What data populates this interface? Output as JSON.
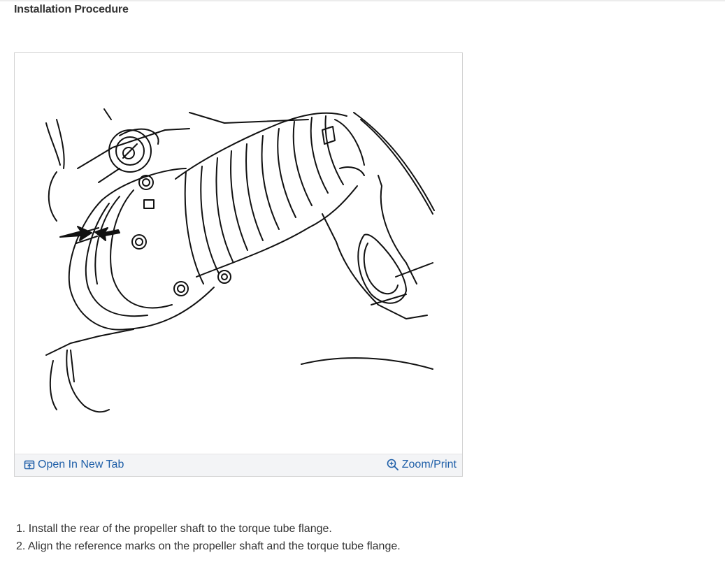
{
  "page": {
    "section_title": "Installation Procedure"
  },
  "figure": {
    "open_new_tab_label": "Open In New Tab",
    "zoom_print_label": "Zoom/Print",
    "link_color": "#1f5fa8",
    "icons": {
      "open_new_tab": "open-new-tab-icon",
      "zoom": "zoom-in-icon"
    }
  },
  "steps": [
    "1. Install the rear of the propeller shaft to the torque tube flange.",
    "2. Align the reference marks on the propeller shaft and the torque tube flange."
  ]
}
